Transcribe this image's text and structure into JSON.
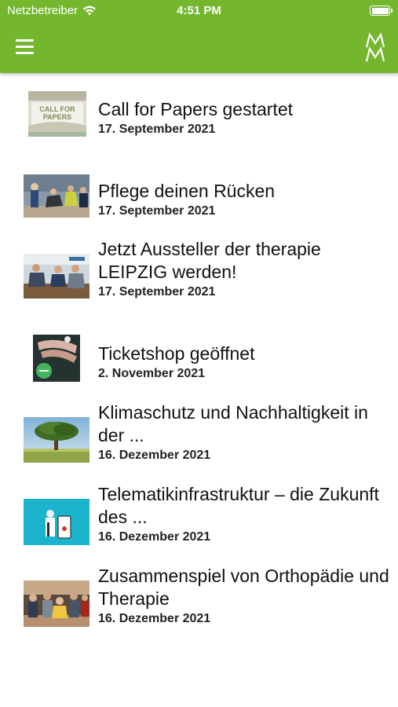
{
  "status_bar": {
    "carrier": "Netzbetreiber",
    "time": "4:51 PM",
    "wifi_icon": "wifi-icon",
    "battery_icon": "battery-icon"
  },
  "header": {
    "menu_icon": "hamburger-menu-icon",
    "logo_icon": "double-m-logo-icon",
    "background_color": "#74b72e"
  },
  "news": [
    {
      "title": "Call for Papers gestartet",
      "date": "17. September 2021",
      "image_text": "CALL FOR PAPERS"
    },
    {
      "title": "Pflege deinen Rücken",
      "date": "17. September 2021"
    },
    {
      "title": "Jetzt Aussteller der therapie LEIPZIG werden!",
      "date": "17. September 2021"
    },
    {
      "title": "Ticketshop geöffnet",
      "date": "2. November 2021"
    },
    {
      "title": "Klimaschutz und Nachhaltigkeit in der ...",
      "date": "16. Dezember 2021"
    },
    {
      "title": "Telematikinfrastruktur – die Zukunft des ...",
      "date": "16. Dezember 2021"
    },
    {
      "title": "Zusammenspiel von Orthopädie und Therapie",
      "date": "16. Dezember 2021"
    }
  ]
}
